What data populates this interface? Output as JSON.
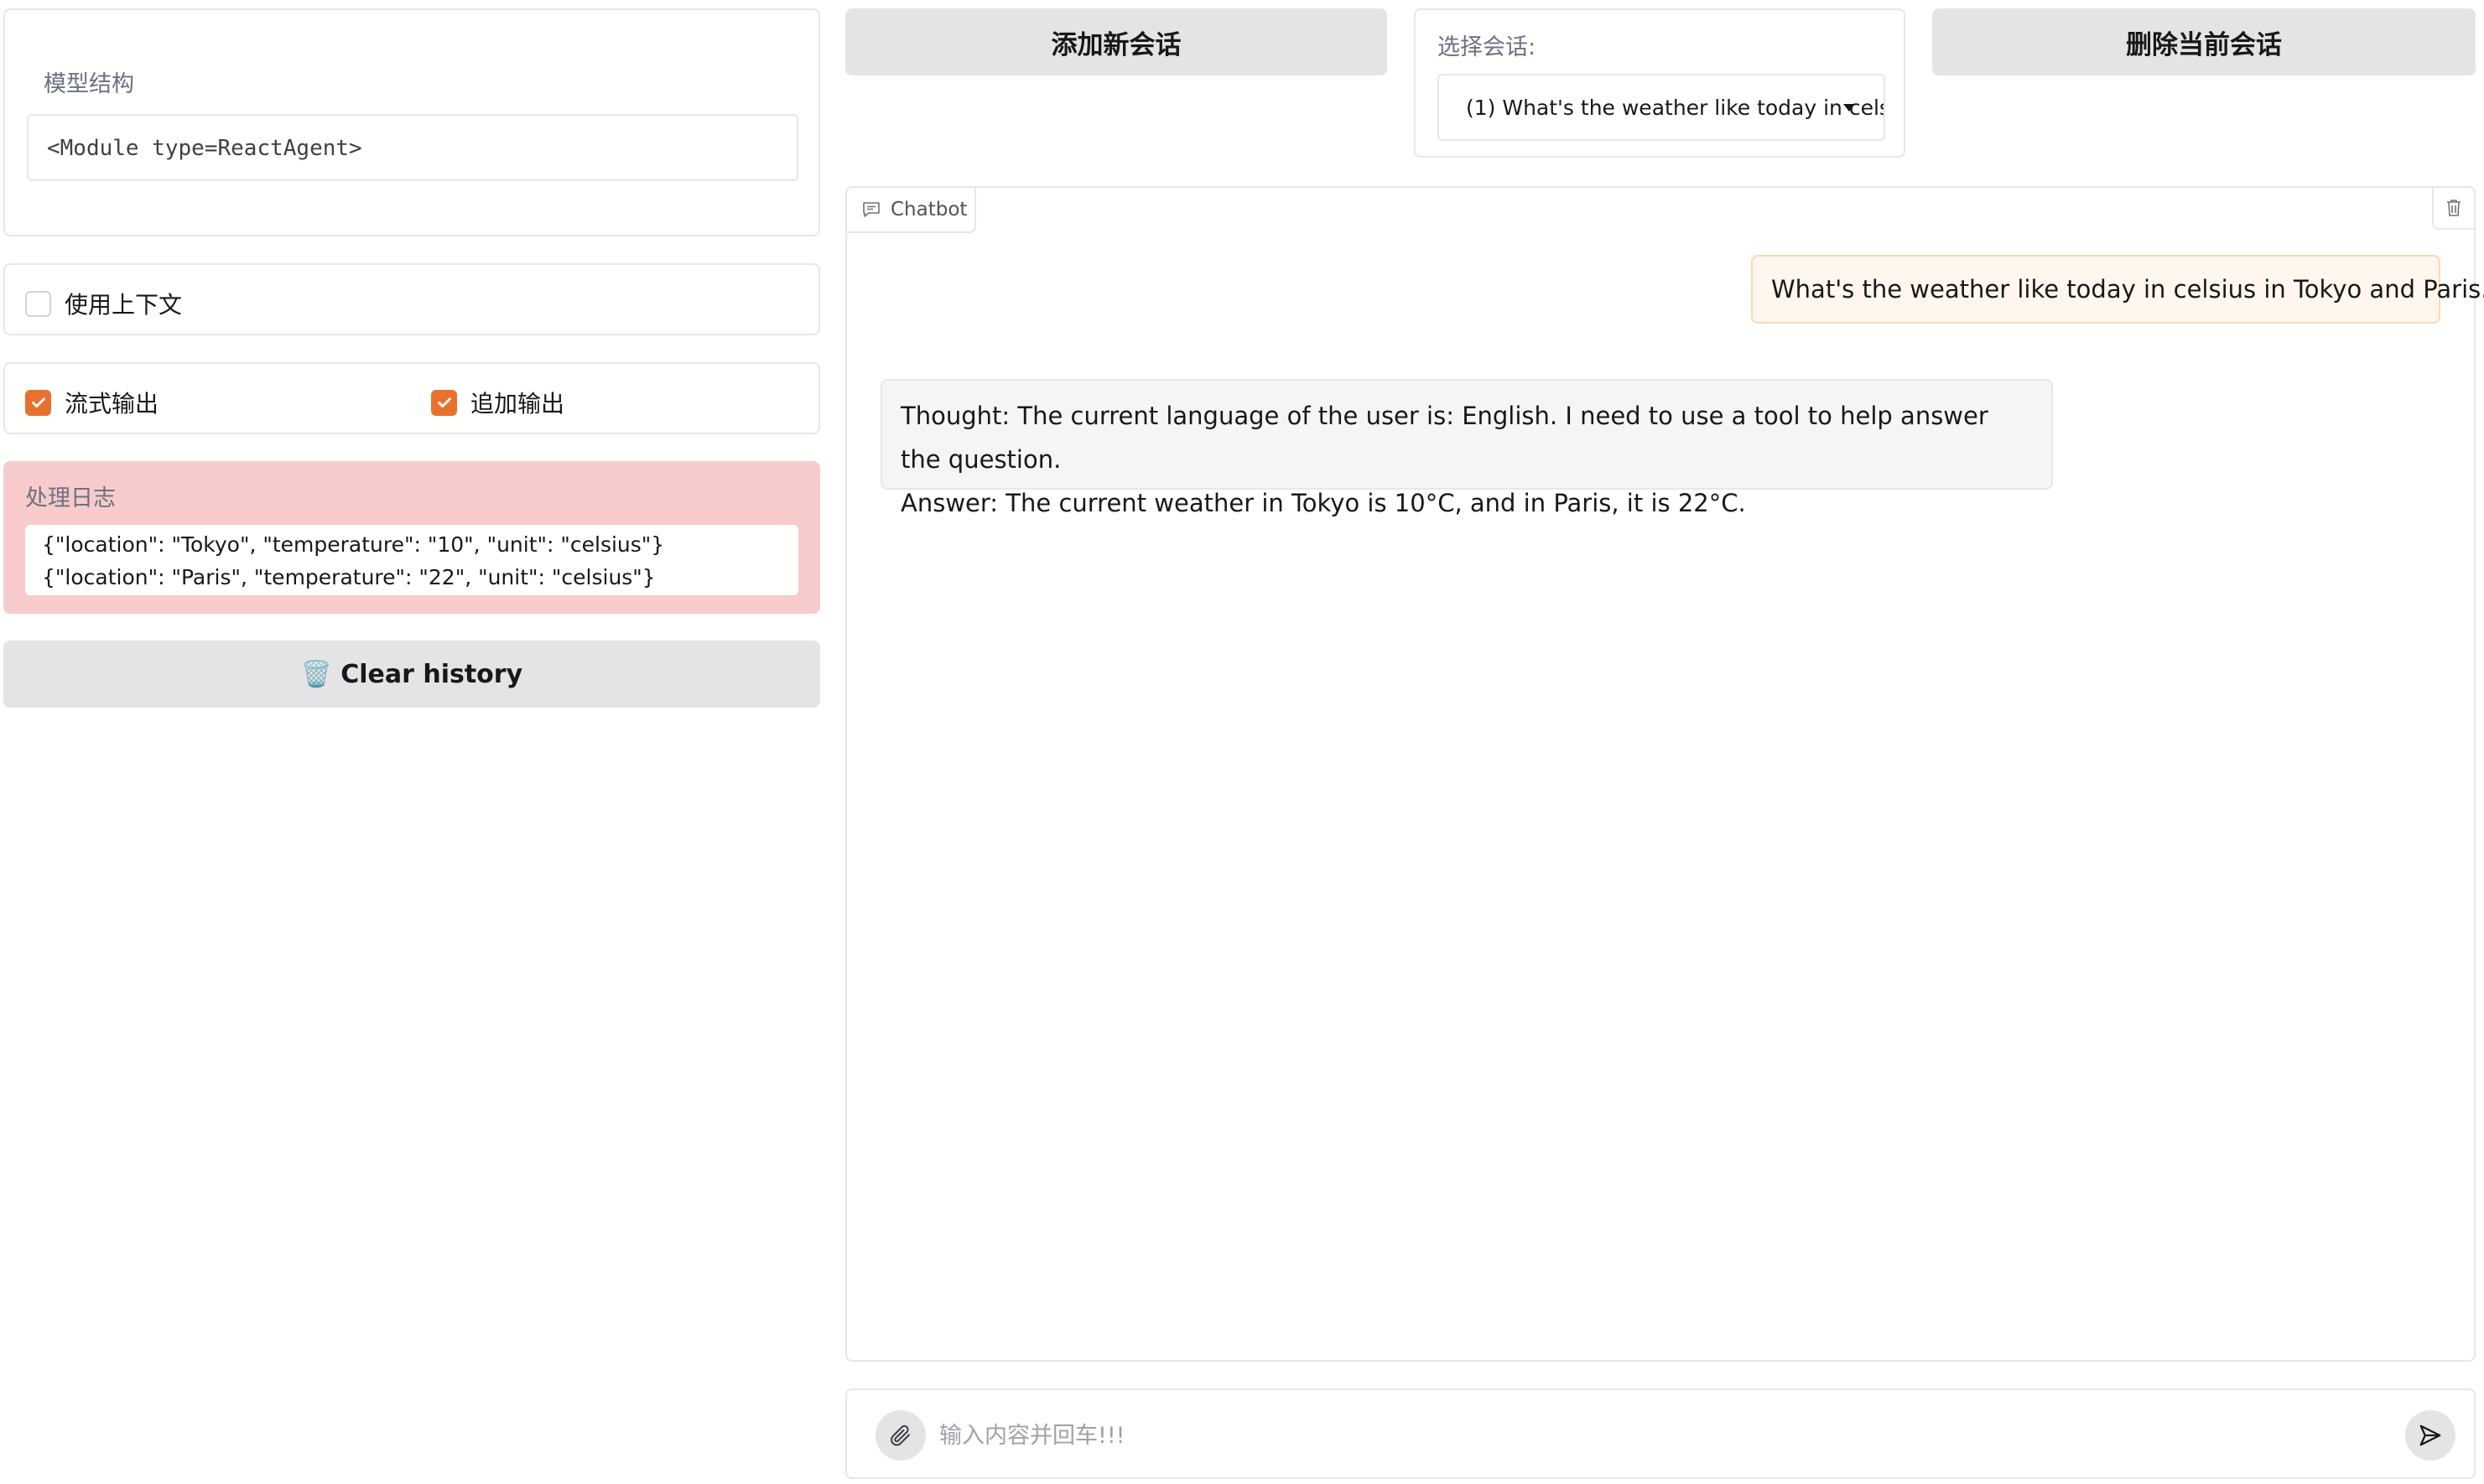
{
  "left": {
    "model_label": "模型结构",
    "model_value": "<Module type=ReactAgent>",
    "use_context_label": "使用上下文",
    "use_context_checked": false,
    "stream_output_label": "流式输出",
    "stream_output_checked": true,
    "append_output_label": "追加输出",
    "append_output_checked": true,
    "log_label": "处理日志",
    "log_value": "{\"location\": \"Tokyo\", \"temperature\": \"10\", \"unit\": \"celsius\"}{\"location\": \"Paris\", \"temperature\": \"22\", \"unit\": \"celsius\"}",
    "clear_history_label": "Clear history",
    "clear_history_icon": "🗑️"
  },
  "top": {
    "add_session_label": "添加新会话",
    "select_session_label": "选择会话:",
    "selected_session": "(1)  What's the weather like today in cels",
    "delete_session_label": "删除当前会话"
  },
  "chatbot": {
    "tag_label": "Chatbot",
    "messages": [
      {
        "role": "user",
        "text": "What's the weather like today in celsius in Tokyo and Paris."
      },
      {
        "role": "assistant",
        "lines": [
          "Thought: The current language of the user is: English. I need to use a tool to help answer the question.",
          "Answer: The current weather in Tokyo is 10°C, and in Paris, it is 22°C."
        ]
      }
    ]
  },
  "input": {
    "placeholder": "输入内容并回车!!!",
    "value": ""
  },
  "colors": {
    "accent": "#e8712d",
    "log_background": "#f7cbcb",
    "user_bubble": "#fff7ed",
    "button_gray": "#e4e4e7"
  }
}
